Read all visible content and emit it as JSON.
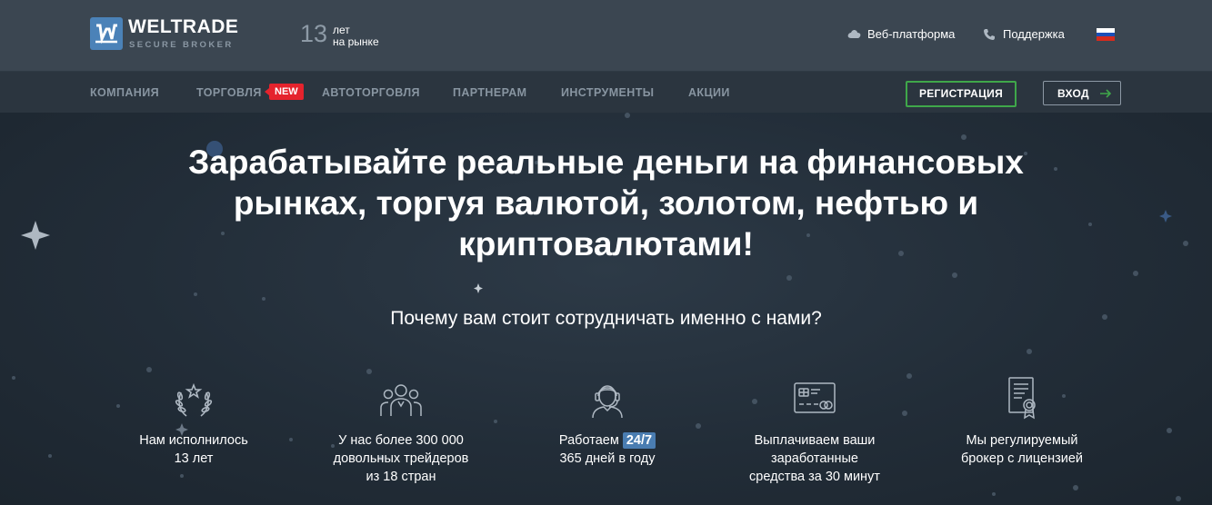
{
  "header": {
    "logo_name": "WELTRADE",
    "logo_tagline": "SECURE BROKER",
    "years_number": "13",
    "years_line1": "лет",
    "years_line2": "на рынке",
    "web_platform": "Веб-платформа",
    "support": "Поддержка",
    "language": "Русский",
    "flag_colors": [
      "#ffffff",
      "#1c4fb8",
      "#d52b1e"
    ]
  },
  "nav": {
    "items": [
      "КОМПАНИЯ",
      "ТОРГОВЛЯ",
      "АВТОТОРГОВЛЯ",
      "ПАРТНЕРАМ",
      "ИНСТРУМЕНТЫ",
      "АКЦИИ"
    ],
    "new_badge": "NEW",
    "register_label": "РЕГИСТРАЦИЯ",
    "login_label": "ВХОД"
  },
  "hero": {
    "headline_line1": "Зарабатывайте реальные деньги на финансовых",
    "headline_line2": "рынках, торгуя валютой, золотом, нефтью и",
    "headline_line3": "криптовалютами!",
    "subheadline": "Почему вам стоит сотрудничать именно с нами?"
  },
  "features": [
    {
      "icon": "laurel-icon",
      "line1": "Нам исполнилось",
      "line2": "13 лет"
    },
    {
      "icon": "people-icon",
      "line1": "У нас более 300 000",
      "line2": "довольных трейдеров",
      "line3": "из 18 стран"
    },
    {
      "icon": "operator-icon",
      "line1_prefix": "Работаем",
      "line1_pill": "24/7",
      "line2": "365 дней в году"
    },
    {
      "icon": "credit-card-icon",
      "line1": "Выплачиваем ваши",
      "line2": "заработанные",
      "line3": "средства за 30 минут"
    },
    {
      "icon": "certificate-icon",
      "line1": "Мы регулируемый",
      "line2": "брокер с лицензией"
    }
  ],
  "colors": {
    "header_bg": "#3b4651",
    "nav_bg": "#2b353f",
    "accent_blue": "#4a7db1",
    "register_green": "#3fa74a",
    "new_red": "#e5232d"
  }
}
